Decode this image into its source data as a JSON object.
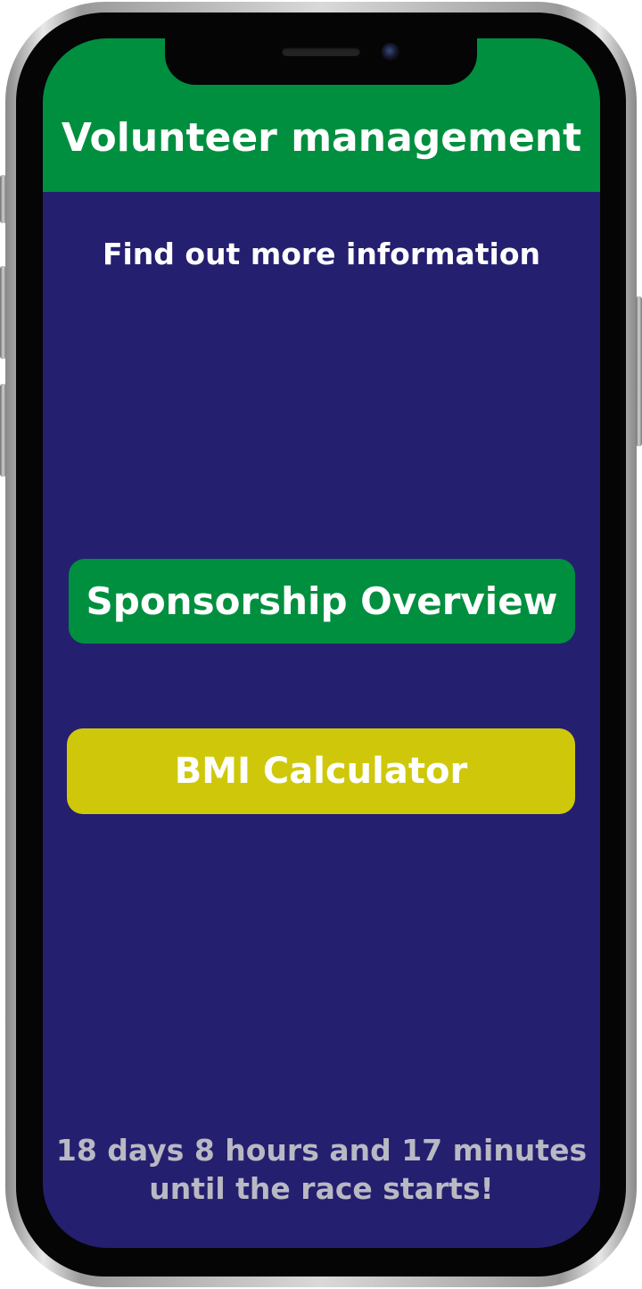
{
  "header": {
    "title": "Volunteer management"
  },
  "main": {
    "subtitle": "Find out more information",
    "buttons": {
      "sponsorship": "Sponsorship Overview",
      "bmi": "BMI Calculator"
    },
    "countdown": {
      "line1": "18 days 8 hours and 17 minutes",
      "line2": "until the race starts!"
    }
  },
  "colors": {
    "header_bg": "#008f3f",
    "screen_bg": "#251f70",
    "sponsorship_button": "#008f3f",
    "bmi_button": "#cfc80a",
    "countdown_text": "#b9b9c3"
  }
}
